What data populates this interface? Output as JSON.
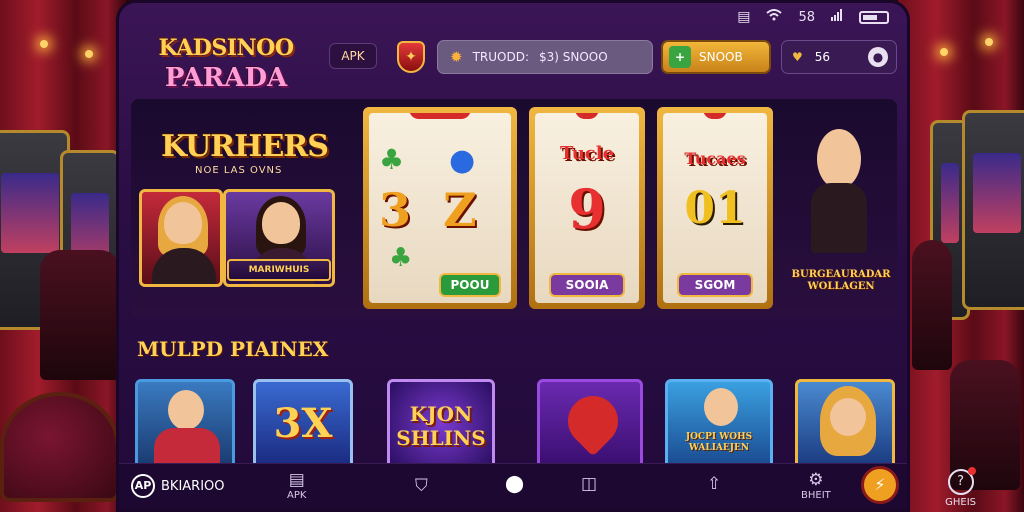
{
  "status_bar": {
    "icon_left": "▤",
    "signal_label": "58",
    "wifi_icon": "wifi-icon",
    "battery_icon": "battery-icon"
  },
  "header": {
    "logo_line1": "KADSINOO",
    "logo_line2": "PARADA",
    "apk_label": "APK",
    "search_text": "TRUODD:",
    "search_value": "$3) SNOOO",
    "balance_label": "SNOOB",
    "user_value": "56"
  },
  "hero": {
    "title": "KURHERS",
    "subtitle": "NOE LAS OVNS",
    "card_banner": "MARIWHUIS",
    "reels": [
      {
        "top_symbols": [
          "♣",
          "●"
        ],
        "mid": "3",
        "mid2": "Z",
        "button": "POOU",
        "button_color": "#2a9a3a"
      },
      {
        "title": "Tucle",
        "mid": "9",
        "button": "SOOIA",
        "button_color": "#7a3aa0"
      },
      {
        "title": "Tucaes",
        "mid": "01",
        "button": "SGOM",
        "button_color": "#7a3aa0"
      }
    ],
    "promo_label": "BURGEAURADAR WOLLAGEN"
  },
  "section": {
    "title": "MULPD PIAINEX",
    "tiles": [
      {
        "kind": "character",
        "text": ""
      },
      {
        "kind": "text",
        "text": "3X",
        "color": "#ffd256"
      },
      {
        "kind": "text",
        "text": "KJON SHLINS",
        "color": "#ffd256"
      },
      {
        "kind": "gem",
        "text": ""
      },
      {
        "kind": "character",
        "text": "JOCPI WOHS WALIAEJEN"
      },
      {
        "kind": "character",
        "text": ""
      }
    ]
  },
  "bottom_nav": {
    "logo_text": "BKIARIOO",
    "logo_mark": "AP",
    "items": [
      "APK",
      "",
      "",
      "",
      "",
      "BHEIT"
    ],
    "outside_label": "GHEIS"
  },
  "colors": {
    "accent_gold": "#f0b840",
    "panel_purple": "#3b1556",
    "cta_green": "#3aa540"
  }
}
